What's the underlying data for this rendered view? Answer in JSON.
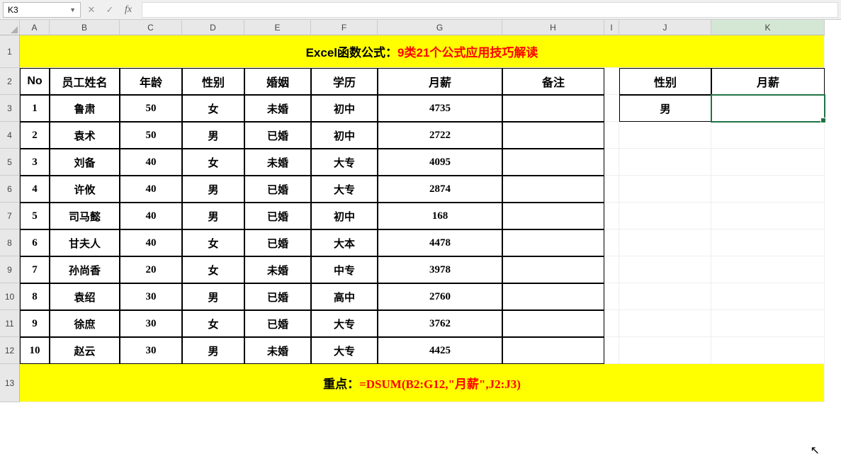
{
  "formula_bar": {
    "name_box": "K3",
    "fx_label": "fx",
    "formula": ""
  },
  "columns": [
    "A",
    "B",
    "C",
    "D",
    "E",
    "F",
    "G",
    "H",
    "I",
    "J",
    "K"
  ],
  "active_column": "K",
  "rows": [
    "1",
    "2",
    "3",
    "4",
    "5",
    "6",
    "7",
    "8",
    "9",
    "10",
    "11",
    "12",
    "13"
  ],
  "title": {
    "prefix": "Excel函数公式：",
    "main": "9类21个公式应用技巧解读"
  },
  "headers": {
    "no": "No",
    "name": "员工姓名",
    "age": "年龄",
    "gender": "性别",
    "marriage": "婚姻",
    "education": "学历",
    "salary": "月薪",
    "note": "备注",
    "crit_gender": "性别",
    "crit_salary": "月薪"
  },
  "criteria": {
    "gender_value": "男",
    "salary_value": ""
  },
  "employees": [
    {
      "no": "1",
      "name": "鲁肃",
      "age": "50",
      "gender": "女",
      "marriage": "未婚",
      "education": "初中",
      "salary": "4735",
      "note": ""
    },
    {
      "no": "2",
      "name": "袁术",
      "age": "50",
      "gender": "男",
      "marriage": "已婚",
      "education": "初中",
      "salary": "2722",
      "note": ""
    },
    {
      "no": "3",
      "name": "刘备",
      "age": "40",
      "gender": "女",
      "marriage": "未婚",
      "education": "大专",
      "salary": "4095",
      "note": ""
    },
    {
      "no": "4",
      "name": "许攸",
      "age": "40",
      "gender": "男",
      "marriage": "已婚",
      "education": "大专",
      "salary": "2874",
      "note": ""
    },
    {
      "no": "5",
      "name": "司马懿",
      "age": "40",
      "gender": "男",
      "marriage": "已婚",
      "education": "初中",
      "salary": "168",
      "note": ""
    },
    {
      "no": "6",
      "name": "甘夫人",
      "age": "40",
      "gender": "女",
      "marriage": "已婚",
      "education": "大本",
      "salary": "4478",
      "note": ""
    },
    {
      "no": "7",
      "name": "孙尚香",
      "age": "20",
      "gender": "女",
      "marriage": "未婚",
      "education": "中专",
      "salary": "3978",
      "note": ""
    },
    {
      "no": "8",
      "name": "袁绍",
      "age": "30",
      "gender": "男",
      "marriage": "已婚",
      "education": "高中",
      "salary": "2760",
      "note": ""
    },
    {
      "no": "9",
      "name": "徐庶",
      "age": "30",
      "gender": "女",
      "marriage": "已婚",
      "education": "大专",
      "salary": "3762",
      "note": ""
    },
    {
      "no": "10",
      "name": "赵云",
      "age": "30",
      "gender": "男",
      "marriage": "未婚",
      "education": "大专",
      "salary": "4425",
      "note": ""
    }
  ],
  "footer": {
    "prefix": "重点：",
    "formula": "=DSUM(B2:G12,\"月薪\",J2:J3)"
  }
}
